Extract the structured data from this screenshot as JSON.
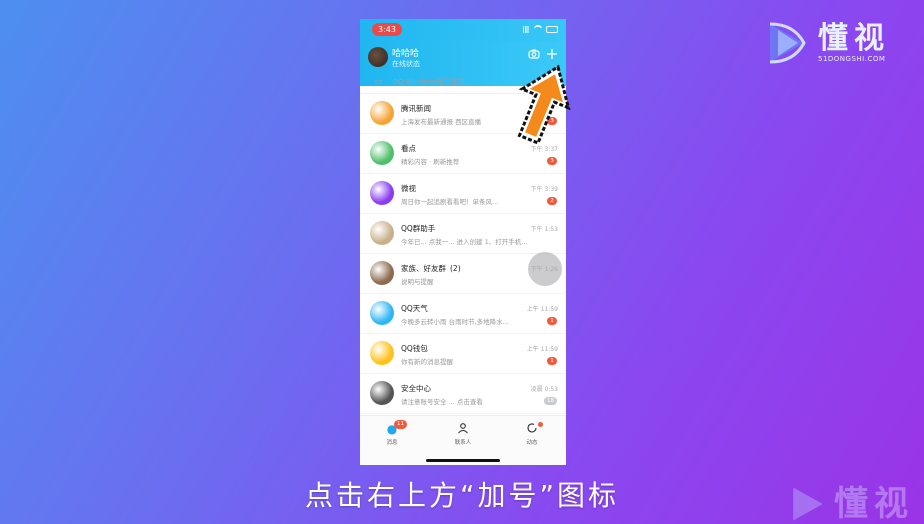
{
  "status_bar": {
    "time": "3:43"
  },
  "header": {
    "name": "哈哈哈",
    "status": "在线状态"
  },
  "search_row": {
    "text": "QQ Windows版已登录"
  },
  "conversations": [
    {
      "name": "腾讯新闻",
      "preview": "上海发布最新通报 西区直播",
      "time": "",
      "badge": "3",
      "color": "#f6a335"
    },
    {
      "name": "看点",
      "preview": "精彩内容 · 刷新推荐",
      "time": "下午 3:37",
      "badge": "3",
      "color": "#4fbf6a"
    },
    {
      "name": "微视",
      "preview": "周日你一起追剧看看吧！单条风...",
      "time": "下午 3:39",
      "badge": "2",
      "color": "#8a3cf0"
    },
    {
      "name": "QQ群助手",
      "preview": "今年已... 点我一... 进入创建 1、打开手机...",
      "time": "下午 1:53",
      "badge": "",
      "color": "#c8b08a"
    },
    {
      "name": "家族、好友群",
      "suffix": "(2)",
      "preview": "说明与提醒",
      "time": "下午 1:26",
      "badge": "",
      "color": "#8d6b4e"
    },
    {
      "name": "QQ天气",
      "preview": "今晚多云转小雨 台雨时节,多地降水...",
      "time": "上午 11:59",
      "badge": "1",
      "color": "#30b6f4"
    },
    {
      "name": "QQ钱包",
      "preview": "你有新的消息提醒",
      "time": "上午 11:59",
      "badge": "1",
      "color": "#ffc21a"
    },
    {
      "name": "安全中心",
      "preview": "请注意账号安全  ... 点击查看",
      "time": "凌晨 0:53",
      "badge": "18",
      "badge_gray": true,
      "color": "#555555"
    }
  ],
  "tabs": [
    {
      "label": "消息",
      "badge": "11"
    },
    {
      "label": "联系人"
    },
    {
      "label": "动态"
    }
  ],
  "caption": "点击右上方“加号”图标",
  "brand": {
    "name": "懂视",
    "url": "51DONGSHI.COM"
  }
}
